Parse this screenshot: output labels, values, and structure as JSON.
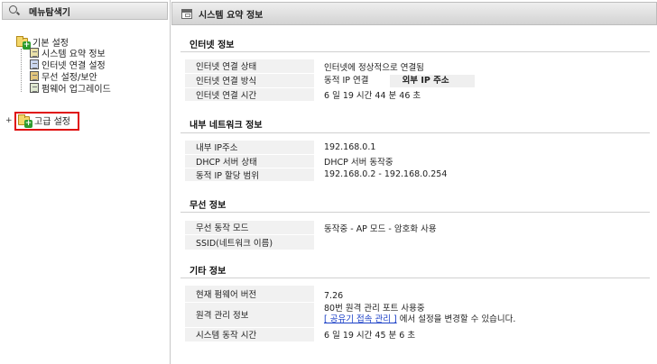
{
  "sidebar": {
    "title": "메뉴탐색기",
    "basic": {
      "label": "기본 설정",
      "items": [
        {
          "label": "시스템 요약 정보"
        },
        {
          "label": "인터넷 연결 설정"
        },
        {
          "label": "무선 설정/보안"
        },
        {
          "label": "펌웨어 업그레이드"
        }
      ]
    },
    "advanced": {
      "label": "고급 설정",
      "expander": "+"
    }
  },
  "main": {
    "title": "시스템 요약 정보",
    "sections": {
      "internet": {
        "title": "인터넷 정보",
        "rows": [
          {
            "label": "인터넷 연결 상태",
            "value": "인터넷에 정상적으로 연결됨"
          },
          {
            "label": "인터넷 연결 방식",
            "value": "동적 IP 연결",
            "button": "외부 IP 주소"
          },
          {
            "label": "인터넷 연결 시간",
            "value": "6 일 19 시간 44 분 46 초"
          }
        ]
      },
      "lan": {
        "title": "내부 네트워크 정보",
        "rows": [
          {
            "label": "내부 IP주소",
            "value": "192.168.0.1"
          },
          {
            "label": "DHCP 서버 상태",
            "value": "DHCP 서버 동작중"
          },
          {
            "label": "동적 IP 할당 범위",
            "value": "192.168.0.2 - 192.168.0.254"
          }
        ]
      },
      "wireless": {
        "title": "무선 정보",
        "rows": [
          {
            "label": "무선 동작 모드",
            "value": "동작중 - AP 모드 - 암호화 사용"
          },
          {
            "label": "SSID(네트워크 이름)",
            "value": ""
          }
        ]
      },
      "other": {
        "title": "기타 정보",
        "rows": [
          {
            "label": "현재 펌웨어 버전",
            "value": "7.26"
          },
          {
            "label": "원격 관리 정보",
            "value": "80번 원격 관리 포트 사용중",
            "link": "[ 공유기 접속 관리 ]",
            "link_suffix": "에서 설정을 변경할 수 있습니다."
          },
          {
            "label": "시스템 동작 시간",
            "value": "6 일 19 시간 45 분 6 초"
          }
        ]
      }
    }
  }
}
